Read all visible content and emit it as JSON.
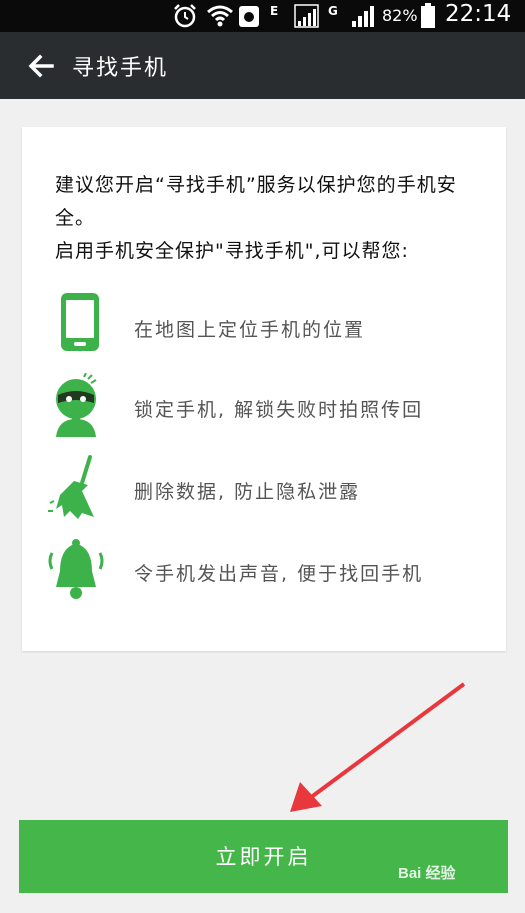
{
  "status_bar": {
    "battery_percent": "82%",
    "time": "22:14",
    "network_e": "E",
    "network_g": "G",
    "icons": [
      "alarm-icon",
      "wifi-icon",
      "app-notification-icon",
      "signal-icon",
      "signal-icon",
      "battery-icon"
    ]
  },
  "app_bar": {
    "title": "寻找手机",
    "back_icon": "back-arrow-icon"
  },
  "card": {
    "intro_line1": "建议您开启“寻找手机”服务以保护您的手机安全。",
    "intro_line2": "启用手机安全保护\"寻找手机\",可以帮您:",
    "features": [
      {
        "icon": "phone-icon",
        "label": "在地图上定位手机的位置"
      },
      {
        "icon": "thief-icon",
        "label": "锁定手机, 解锁失败时拍照传回"
      },
      {
        "icon": "broom-icon",
        "label": "删除数据, 防止隐私泄露"
      },
      {
        "icon": "ringing-bell-icon",
        "label": "令手机发出声音, 便于找回手机"
      }
    ]
  },
  "action": {
    "start_label": "立即开启"
  },
  "watermark": "Bai 经验",
  "colors": {
    "accent_green": "#45b649",
    "app_bar": "#2a2d2f",
    "status_bar": "#0a0a0a",
    "annotation_arrow": "#e8383d"
  }
}
